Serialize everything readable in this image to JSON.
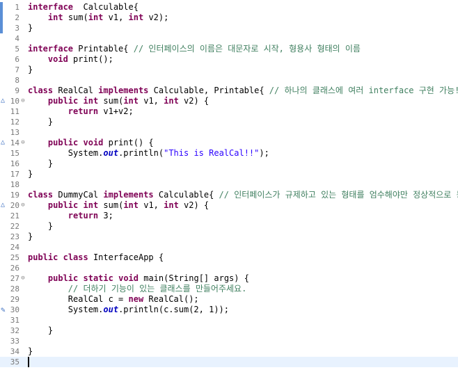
{
  "lines": [
    {
      "n": "1",
      "tokens": [
        [
          "kw",
          "interface"
        ],
        [
          "",
          "  Calculable{"
        ]
      ]
    },
    {
      "n": "2",
      "tokens": [
        [
          "",
          "    "
        ],
        [
          "kw",
          "int"
        ],
        [
          "",
          " sum("
        ],
        [
          "kw",
          "int"
        ],
        [
          "",
          " v1, "
        ],
        [
          "kw",
          "int"
        ],
        [
          "",
          " v2);"
        ]
      ]
    },
    {
      "n": "3",
      "tokens": [
        [
          "",
          "}"
        ]
      ]
    },
    {
      "n": "4",
      "tokens": []
    },
    {
      "n": "5",
      "tokens": [
        [
          "kw",
          "interface"
        ],
        [
          "",
          " Printable{ "
        ],
        [
          "cm",
          "// 인터페이스의 이름은 대문자로 시작, 형용사 형태의 이름"
        ]
      ]
    },
    {
      "n": "6",
      "tokens": [
        [
          "",
          "    "
        ],
        [
          "kw",
          "void"
        ],
        [
          "",
          " print();"
        ]
      ]
    },
    {
      "n": "7",
      "tokens": [
        [
          "",
          "}"
        ]
      ]
    },
    {
      "n": "8",
      "tokens": []
    },
    {
      "n": "9",
      "tokens": [
        [
          "kw",
          "class"
        ],
        [
          "",
          " RealCal "
        ],
        [
          "kw",
          "implements"
        ],
        [
          "",
          " Calculable, Printable{ "
        ],
        [
          "cm",
          "// 하나의 클래스에 여러 interface 구현 가능!"
        ]
      ]
    },
    {
      "n": "10",
      "tokens": [
        [
          "",
          "    "
        ],
        [
          "kw",
          "public"
        ],
        [
          "",
          " "
        ],
        [
          "kw",
          "int"
        ],
        [
          "",
          " sum("
        ],
        [
          "kw",
          "int"
        ],
        [
          "",
          " v1, "
        ],
        [
          "kw",
          "int"
        ],
        [
          "",
          " v2) {"
        ]
      ]
    },
    {
      "n": "11",
      "tokens": [
        [
          "",
          "        "
        ],
        [
          "kw",
          "return"
        ],
        [
          "",
          " v1+v2;"
        ]
      ]
    },
    {
      "n": "12",
      "tokens": [
        [
          "",
          "    }"
        ]
      ]
    },
    {
      "n": "13",
      "tokens": []
    },
    {
      "n": "14",
      "tokens": [
        [
          "",
          "    "
        ],
        [
          "kw",
          "public"
        ],
        [
          "",
          " "
        ],
        [
          "kw",
          "void"
        ],
        [
          "",
          " print() {"
        ]
      ]
    },
    {
      "n": "15",
      "tokens": [
        [
          "",
          "        System."
        ],
        [
          "fi",
          "out"
        ],
        [
          "",
          ".println("
        ],
        [
          "st",
          "\"This is RealCal!!\""
        ],
        [
          "",
          ");"
        ]
      ]
    },
    {
      "n": "16",
      "tokens": [
        [
          "",
          "    }"
        ]
      ]
    },
    {
      "n": "17",
      "tokens": [
        [
          "",
          "}"
        ]
      ]
    },
    {
      "n": "18",
      "tokens": []
    },
    {
      "n": "19",
      "tokens": [
        [
          "kw",
          "class"
        ],
        [
          "",
          " DummyCal "
        ],
        [
          "kw",
          "implements"
        ],
        [
          "",
          " Calculable{ "
        ],
        [
          "cm",
          "// 인터페이스가 규제하고 있는 형태를 엄수해야만 정상적으로 동작"
        ]
      ]
    },
    {
      "n": "20",
      "tokens": [
        [
          "",
          "    "
        ],
        [
          "kw",
          "public"
        ],
        [
          "",
          " "
        ],
        [
          "kw",
          "int"
        ],
        [
          "",
          " sum("
        ],
        [
          "kw",
          "int"
        ],
        [
          "",
          " v1, "
        ],
        [
          "kw",
          "int"
        ],
        [
          "",
          " v2) {"
        ]
      ]
    },
    {
      "n": "21",
      "tokens": [
        [
          "",
          "        "
        ],
        [
          "kw",
          "return"
        ],
        [
          "",
          " 3;"
        ]
      ]
    },
    {
      "n": "22",
      "tokens": [
        [
          "",
          "    }"
        ]
      ]
    },
    {
      "n": "23",
      "tokens": [
        [
          "",
          "}"
        ]
      ]
    },
    {
      "n": "24",
      "tokens": []
    },
    {
      "n": "25",
      "tokens": [
        [
          "kw",
          "public"
        ],
        [
          "",
          " "
        ],
        [
          "kw",
          "class"
        ],
        [
          "",
          " InterfaceApp {"
        ]
      ]
    },
    {
      "n": "26",
      "tokens": []
    },
    {
      "n": "27",
      "tokens": [
        [
          "",
          "    "
        ],
        [
          "kw",
          "public"
        ],
        [
          "",
          " "
        ],
        [
          "kw",
          "static"
        ],
        [
          "",
          " "
        ],
        [
          "kw",
          "void"
        ],
        [
          "",
          " main(String[] args) {"
        ]
      ]
    },
    {
      "n": "28",
      "tokens": [
        [
          "",
          "        "
        ],
        [
          "cm",
          "// 더하기 기능이 있는 클래스를 만들어주세요."
        ]
      ]
    },
    {
      "n": "29",
      "tokens": [
        [
          "",
          "        RealCal c = "
        ],
        [
          "kw",
          "new"
        ],
        [
          "",
          " RealCal();"
        ]
      ]
    },
    {
      "n": "30",
      "tokens": [
        [
          "",
          "        System."
        ],
        [
          "fi",
          "out"
        ],
        [
          "",
          ".println(c.sum(2, 1));"
        ]
      ]
    },
    {
      "n": "31",
      "tokens": []
    },
    {
      "n": "32",
      "tokens": [
        [
          "",
          "    }"
        ]
      ]
    },
    {
      "n": "33",
      "tokens": []
    },
    {
      "n": "34",
      "tokens": [
        [
          "",
          "}"
        ]
      ]
    },
    {
      "n": "35",
      "tokens": []
    }
  ],
  "fold_markers": {
    "10": "⊖",
    "14": "⊖",
    "20": "⊖",
    "27": "⊖"
  },
  "override_markers": [
    "10",
    "14",
    "20"
  ],
  "warning_markers": [
    "30"
  ],
  "ruler_lines": [
    "1",
    "2",
    "3"
  ],
  "current_line": "35"
}
